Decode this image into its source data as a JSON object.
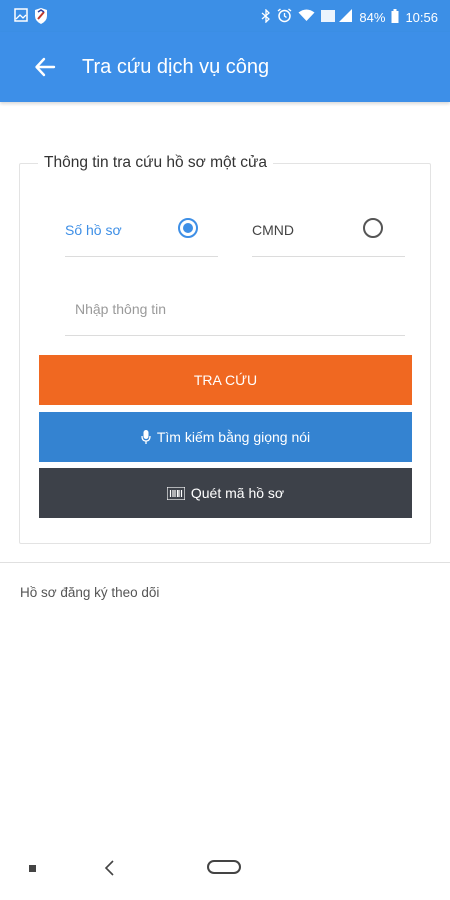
{
  "status_bar": {
    "left_icons": [
      "image-icon",
      "shield-app-icon"
    ],
    "right_icons": [
      "bluetooth-icon",
      "alarm-icon",
      "wifi-icon",
      "signal-icon",
      "battery-icon"
    ],
    "battery": "84%",
    "time": "10:56"
  },
  "app_bar": {
    "title": "Tra cứu dịch vụ công",
    "back_icon": "arrow-left-icon",
    "color": "#3d8fe8"
  },
  "form": {
    "legend": "Thông tin tra cứu hồ sơ một cửa",
    "options": [
      {
        "label": "Số hồ sơ",
        "selected": true
      },
      {
        "label": "CMND",
        "selected": false
      }
    ],
    "input_placeholder": "Nhập thông tin",
    "input_value": "",
    "buttons": {
      "search": "TRA CỨU",
      "voice": "Tìm kiếm bằng giọng nói",
      "scan": "Quét mã hồ sơ"
    },
    "colors": {
      "search": "#f06821",
      "voice": "#3483d1",
      "scan": "#3d4149",
      "accent": "#3e8fe6"
    }
  },
  "followed_section": {
    "label": "Hồ sơ đăng ký theo dõi"
  },
  "nav_bar": {
    "icons": [
      "recent-apps-icon",
      "back-icon",
      "home-icon"
    ]
  }
}
